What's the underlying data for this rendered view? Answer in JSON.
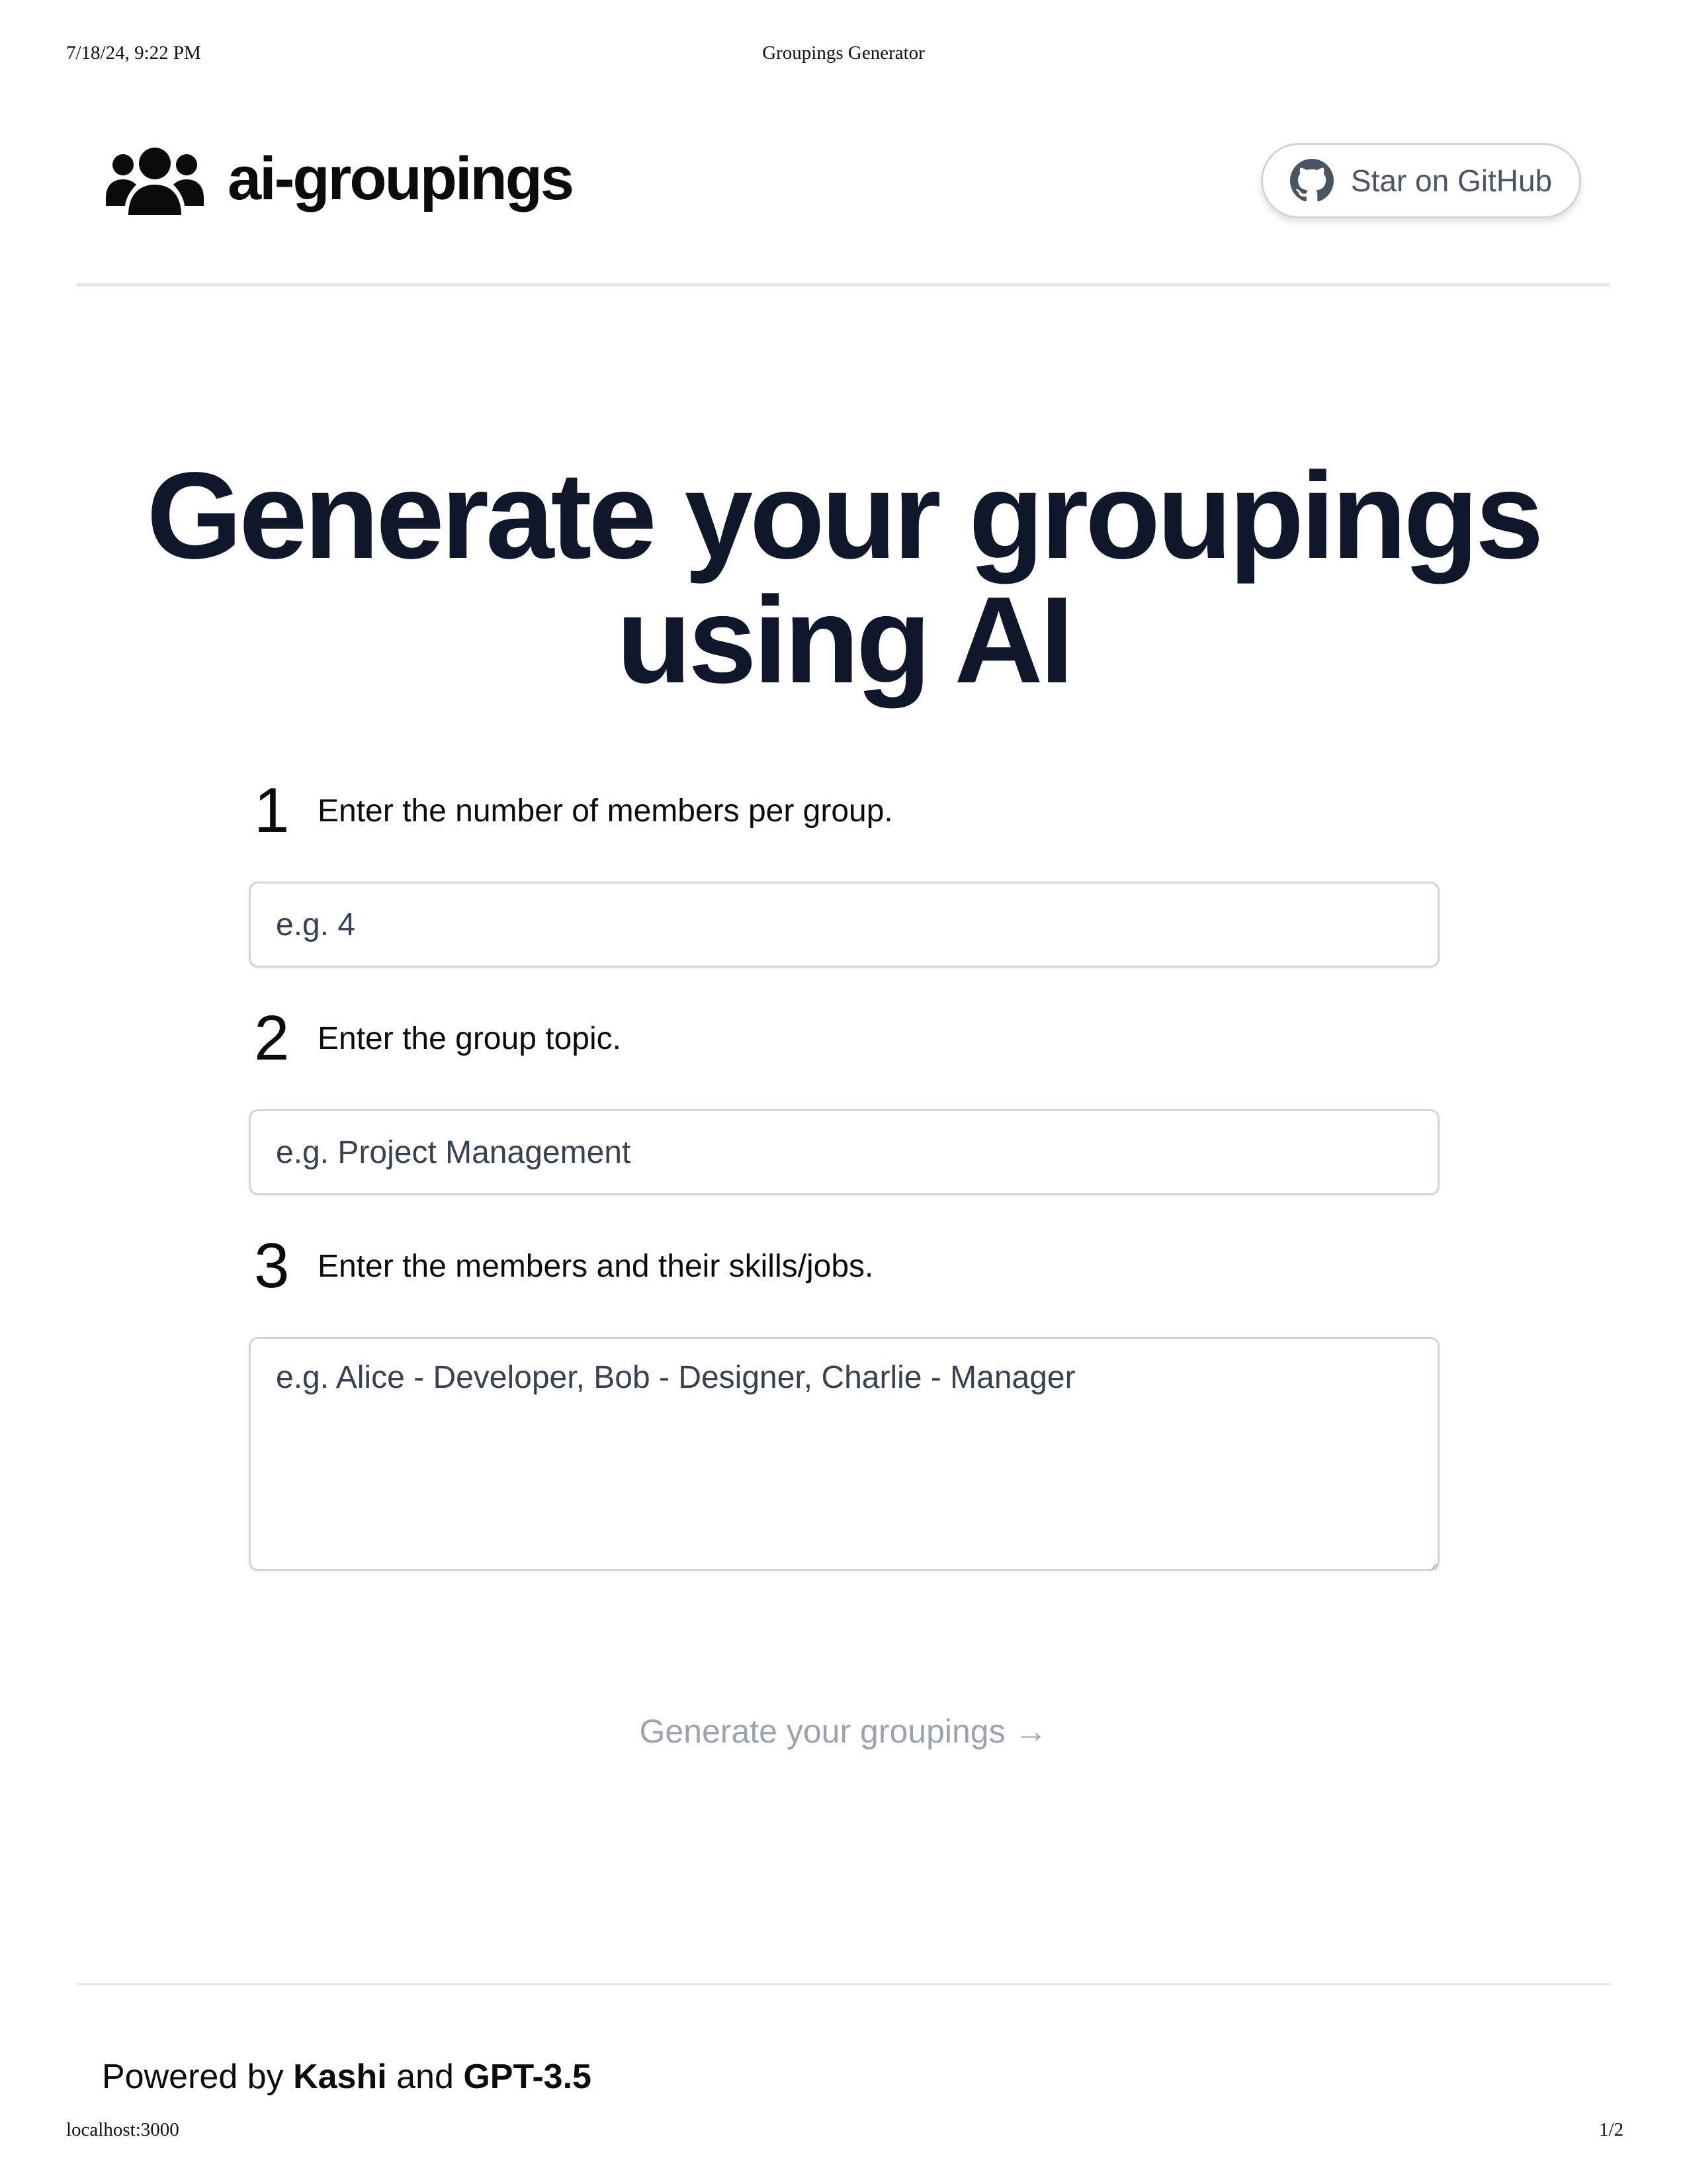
{
  "print": {
    "datetime": "7/18/24, 9:22 PM",
    "doc_title": "Groupings Generator",
    "url": "localhost:3000",
    "page": "1/2"
  },
  "header": {
    "logo_icon": "users-icon",
    "logo_text": "ai-groupings",
    "github_icon": "github-icon",
    "github_label": "Star on GitHub"
  },
  "hero": {
    "line1": "Generate your groupings",
    "line2": "using AI"
  },
  "form": {
    "steps": [
      {
        "number": "1",
        "label": "Enter the number of members per group.",
        "placeholder": "e.g. 4",
        "value": ""
      },
      {
        "number": "2",
        "label": "Enter the group topic.",
        "placeholder": "e.g. Project Management",
        "value": ""
      },
      {
        "number": "3",
        "label": "Enter the members and their skills/jobs.",
        "placeholder": "e.g. Alice - Developer, Bob - Designer, Charlie - Manager",
        "value": ""
      }
    ],
    "submit_label": "Generate your groupings →"
  },
  "footer": {
    "powered_prefix": "Powered by",
    "brand1": "Kashi",
    "joiner": "and",
    "brand2": "GPT-3.5"
  },
  "colors": {
    "heading": "#0f172a",
    "muted_button": "#9ca3af",
    "border": "#d1d5db",
    "github_text": "#4b5563"
  }
}
